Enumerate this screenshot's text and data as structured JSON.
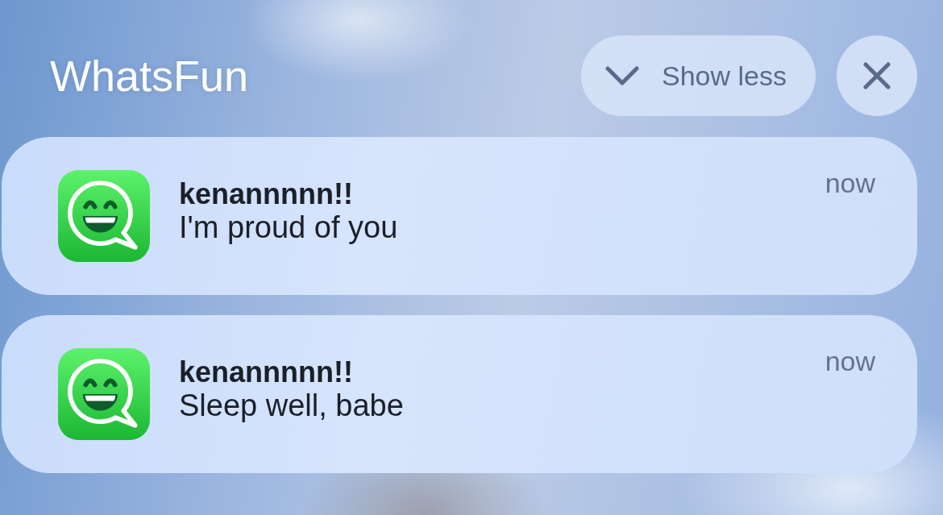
{
  "group": {
    "app_name": "WhatsFun",
    "collapse_button": {
      "label": "Show less"
    }
  },
  "notifications": [
    {
      "sender": "kenannnnn!!",
      "message": "I'm proud of you",
      "time": "now"
    },
    {
      "sender": "kenannnnn!!",
      "message": "Sleep well, babe",
      "time": "now"
    }
  ]
}
